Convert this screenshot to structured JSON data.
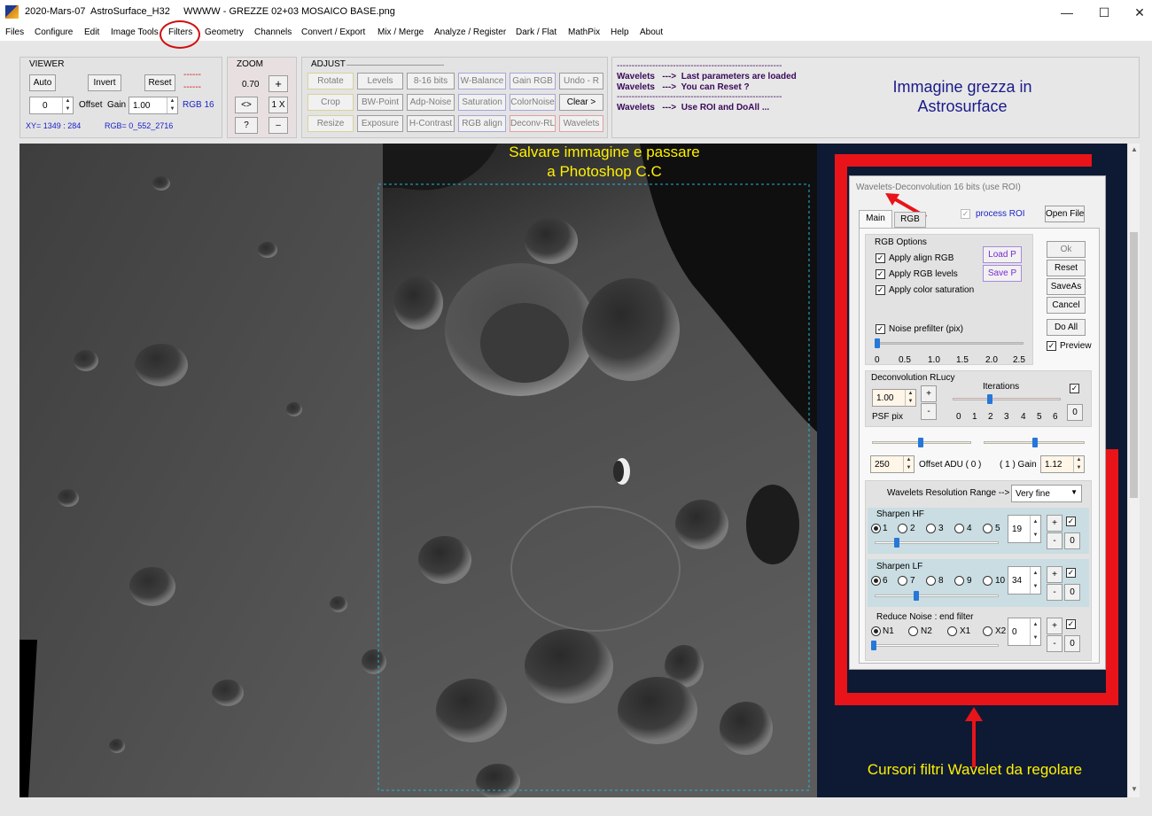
{
  "window": {
    "title": "2020-Mars-07  AstroSurface_H32     WWWW - GREZZE 02+03 MOSAICO BASE.png",
    "minimize": "—",
    "maximize": "☐",
    "close": "✕"
  },
  "menu": [
    "Files",
    "Configure",
    "Edit",
    "Image Tools",
    "Filters",
    "Geometry",
    "Channels",
    "Convert / Export",
    "Mix / Merge",
    "Analyze / Register",
    "Dark / Flat",
    "MathPix",
    "Help",
    "About"
  ],
  "viewer": {
    "title": "VIEWER",
    "auto": "Auto",
    "invert": "Invert",
    "reset": "Reset",
    "dashes1": "------",
    "dashes2": "------",
    "offset_value": "0",
    "offset_label": "Offset",
    "gain_label": "Gain",
    "gain_value": "1.00",
    "rgb16": "RGB 16",
    "xy": "XY=  1349 : 284",
    "rgb": "RGB=  0_552_2716"
  },
  "zoom": {
    "title": "ZOOM",
    "value": "0.70",
    "plus": "+",
    "fit": "<>",
    "onex": "1 X",
    "help": "?",
    "minus": "–"
  },
  "adjust": {
    "title": "ADJUST",
    "buttons": [
      "Rotate",
      "Levels",
      "8-16 bits",
      "W-Balance",
      "Gain RGB",
      "Undo - R",
      "Crop",
      "BW-Point",
      "Adp-Noise",
      "Saturation",
      "ColorNoise",
      "Clear >",
      "Resize",
      "Exposure",
      "H-Contrast",
      "RGB align",
      "Deconv-RL",
      "Wavelets"
    ]
  },
  "messages": {
    "line1": "--------------------------------------------------------",
    "line2": "Wavelets   --->  Last parameters are loaded",
    "line3": "Wavelets   --->  You can Reset ?",
    "line4": "--------------------------------------------------------",
    "line5": "Wavelets   --->  Use ROI and DoAll ..."
  },
  "annotation_top": "Immagine grezza in\nAstrosurface",
  "overlay": {
    "save_text_1": "Salvare immagine e passare",
    "save_text_2": "a Photoshop C.C",
    "bottom_caption": "Cursori filtri Wavelet da regolare"
  },
  "dialog": {
    "title": "Wavelets-Deconvolution 16 bits (use ROI)",
    "tab_main": "Main",
    "tab_rgb": "RGB",
    "process_roi": "process ROI",
    "open_file": "Open File",
    "rgb_options": "RGB Options",
    "apply_align": "Apply align RGB",
    "apply_levels": "Apply RGB levels",
    "apply_sat": "Apply color saturation",
    "load_p": "Load P",
    "save_p": "Save P",
    "ok": "Ok",
    "reset": "Reset",
    "saveas": "SaveAs",
    "cancel": "Cancel",
    "doall": "Do All",
    "preview": "Preview",
    "noise_prefilter": "Noise prefilter (pix)",
    "noise_ticks": [
      "0",
      "0.5",
      "1.0",
      "1.5",
      "2.0",
      "2.5"
    ],
    "deconv_title": "Deconvolution RLucy",
    "psf_value": "1.00",
    "psf_label": "PSF pix",
    "iterations": "Iterations",
    "iter_ticks": [
      "0",
      "1",
      "2",
      "3",
      "4",
      "5",
      "6"
    ],
    "plus": "+",
    "minus": "-",
    "zero": "0",
    "offset_value": "250",
    "offset_label": "Offset ADU ( 0 )",
    "gain_label": "( 1 )  Gain",
    "gain_value": "1.12",
    "range_label": "Wavelets Resolution Range  -->",
    "range_value": "Very fine",
    "sharpen_hf": "Sharpen HF",
    "hf_radios": [
      "1",
      "2",
      "3",
      "4",
      "5"
    ],
    "hf_value": "19",
    "sharpen_lf": "Sharpen LF",
    "lf_radios": [
      "6",
      "7",
      "8",
      "9",
      "10"
    ],
    "lf_value": "34",
    "reduce_noise": "Reduce Noise : end filter",
    "rn_radios": [
      "N1",
      "N2",
      "X1",
      "X2"
    ],
    "rn_value": "0"
  },
  "colors": {
    "accent_red": "#e8141a",
    "caption_yellow": "#fff000",
    "dialog_navy": "#0e1a33"
  }
}
